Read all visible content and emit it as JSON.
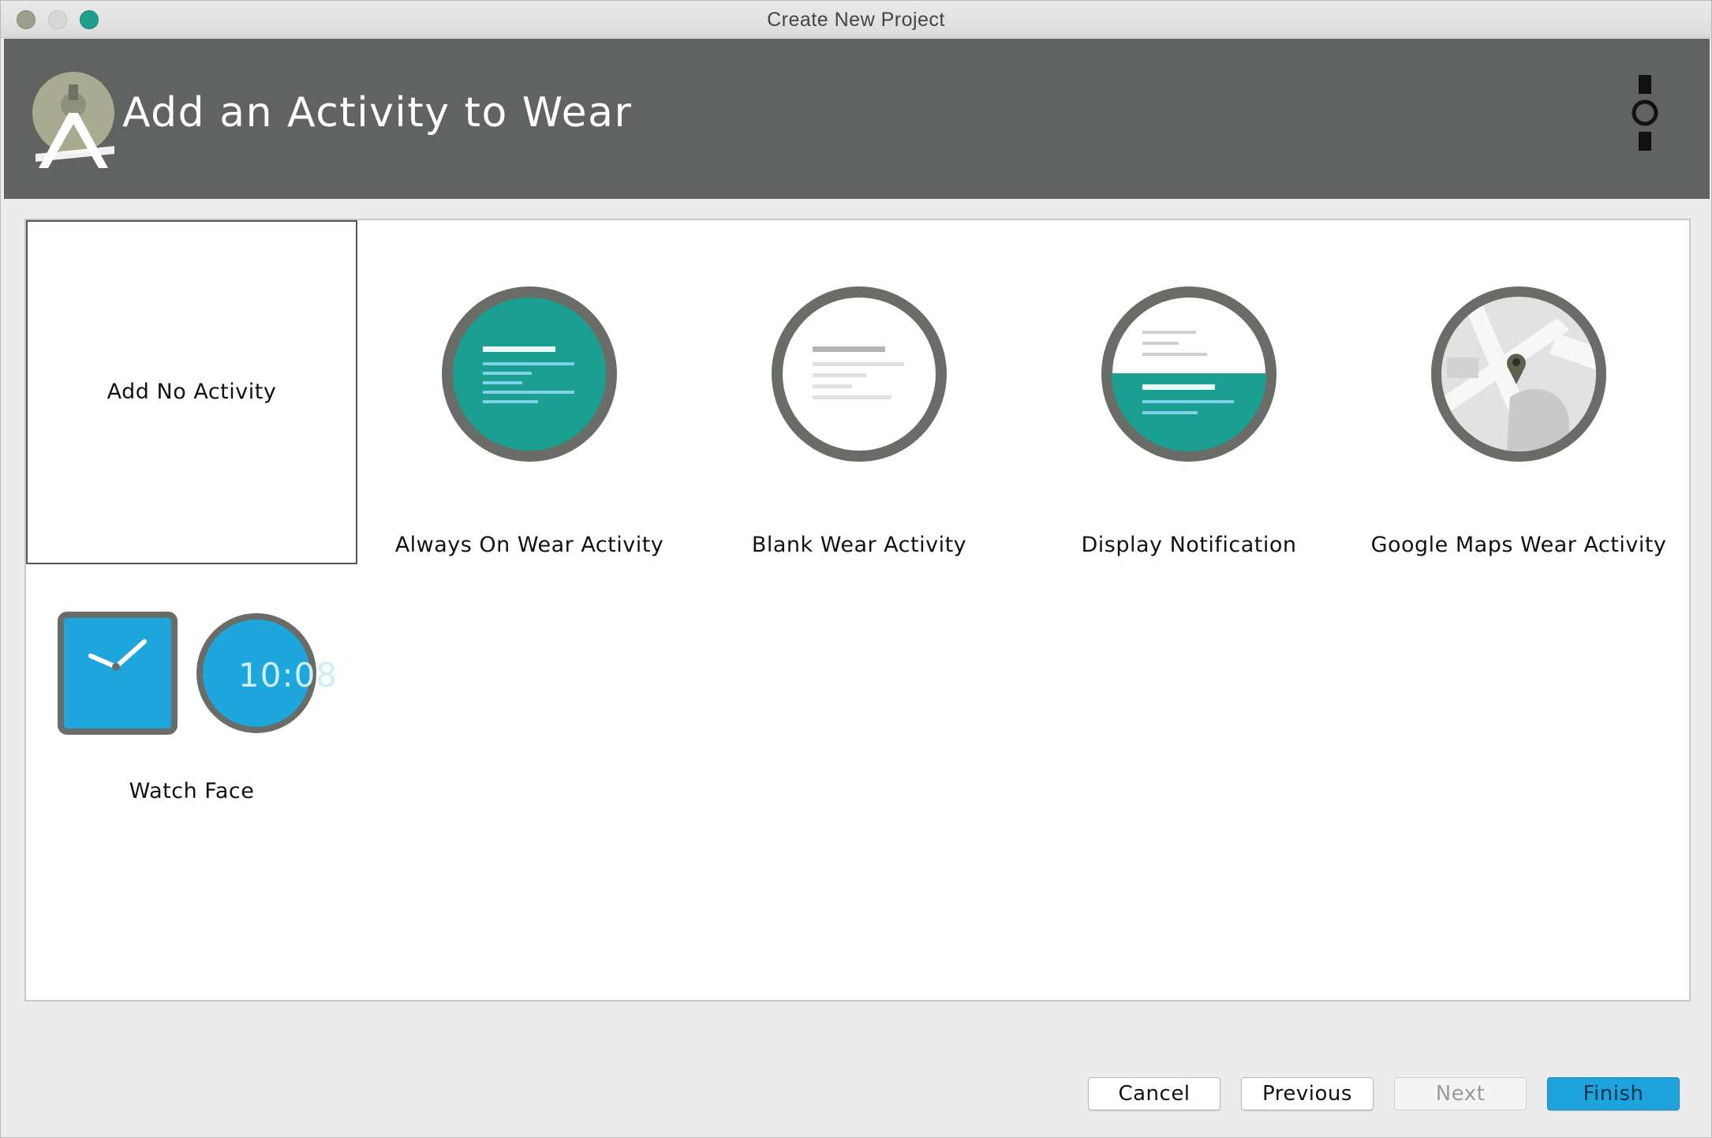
{
  "window": {
    "title": "Create New Project"
  },
  "header": {
    "title": "Add an Activity to Wear"
  },
  "templates": [
    {
      "label": "Add No Activity",
      "selected": true
    },
    {
      "label": "Always On Wear Activity"
    },
    {
      "label": "Blank Wear Activity"
    },
    {
      "label": "Display Notification"
    },
    {
      "label": "Google Maps Wear Activity"
    },
    {
      "label": "Watch Face",
      "clock_time": "10:08"
    }
  ],
  "buttons": {
    "cancel": "Cancel",
    "previous": "Previous",
    "next": "Next",
    "finish": "Finish"
  },
  "colors": {
    "teal": "#1a9f91",
    "watch_blue": "#1fa6dc",
    "bezel": "#6a6c68",
    "header_bg": "#616362",
    "finish_blue": "#1fa3dc"
  }
}
